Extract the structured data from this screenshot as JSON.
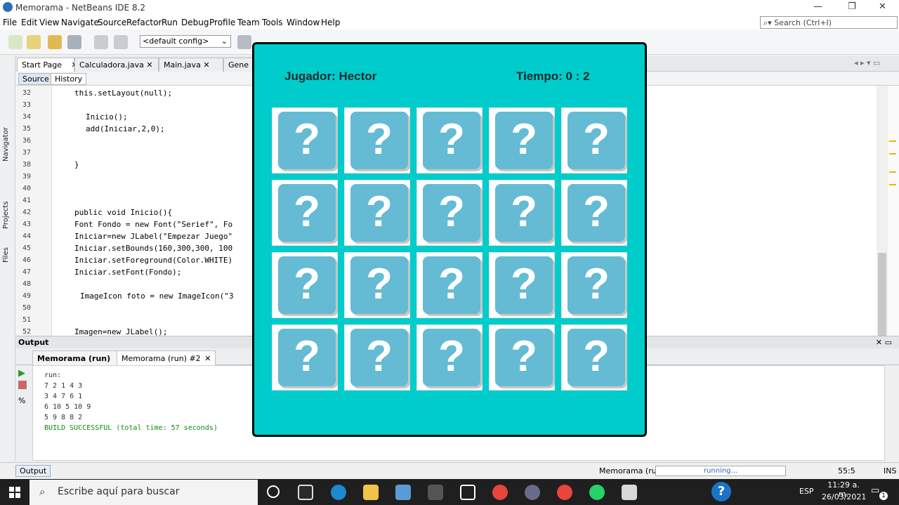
{
  "window": {
    "title": "Memorama - NetBeans IDE 8.2",
    "minimize": "—",
    "restore": "❐",
    "close": "✕"
  },
  "menu": [
    "File",
    "Edit",
    "View",
    "Navigate",
    "Source",
    "Refactor",
    "Run",
    "Debug",
    "Profile",
    "Team",
    "Tools",
    "Window",
    "Help"
  ],
  "toolbar": {
    "config_value": "<default config>"
  },
  "search": {
    "placeholder": "Search (Ctrl+I)"
  },
  "side_tabs": [
    "Navigator",
    "Projects",
    "Files"
  ],
  "editor_tabs": [
    "Start Page",
    "Calculadora.java",
    "Main.java",
    "Gene"
  ],
  "source_bar": {
    "source": "Source",
    "history": "History"
  },
  "code": {
    "lines": [
      {
        "n": "32",
        "text": "this.setLayout(null);"
      },
      {
        "n": "33",
        "text": ""
      },
      {
        "n": "34",
        "text": "Inicio();"
      },
      {
        "n": "35",
        "text": "add(Iniciar,2,0);"
      },
      {
        "n": "36",
        "text": ""
      },
      {
        "n": "37",
        "text": ""
      },
      {
        "n": "38",
        "text": "}"
      },
      {
        "n": "39",
        "text": ""
      },
      {
        "n": "40",
        "text": ""
      },
      {
        "n": "41",
        "text": ""
      },
      {
        "n": "42",
        "text": "public void Inicio(){"
      },
      {
        "n": "43",
        "text": "Font Fondo = new Font(\"Serief\", Fo"
      },
      {
        "n": "44",
        "text": "Iniciar=new JLabel(\"Empezar Juego\""
      },
      {
        "n": "45",
        "text": "Iniciar.setBounds(160,300,300, 100"
      },
      {
        "n": "46",
        "text": "Iniciar.setForeground(Color.WHITE)"
      },
      {
        "n": "47",
        "text": "Iniciar.setFont(Fondo);"
      },
      {
        "n": "48",
        "text": ""
      },
      {
        "n": "49",
        "text": "ImageIcon foto = new ImageIcon(\"3"
      },
      {
        "n": "50",
        "text": ""
      },
      {
        "n": "51",
        "text": ""
      },
      {
        "n": "52",
        "text": "Imagen=new JLabel();"
      }
    ]
  },
  "output": {
    "panel_title": "Output",
    "tabs": [
      "Memorama (run)",
      "Memorama (run) #2"
    ],
    "lines": [
      "run:",
      "7 2 1 4 3",
      "3 4 7 6 1",
      "6 10 5 10 9",
      "5 9 8 8 2",
      "BUILD SUCCESSFUL (total time: 57 seconds)"
    ]
  },
  "status": {
    "output_button": "Output",
    "project": "Memorama (run)",
    "progress": "running...",
    "position": "55:5",
    "mode": "INS"
  },
  "taskbar": {
    "search_placeholder": "Escribe aquí para buscar",
    "time": "11:29 a. m.",
    "date": "26/03/2021",
    "lang": "ESP",
    "notif_count": "1"
  },
  "game": {
    "player": "Jugador: Hector",
    "timer": "Tiempo: 0 : 2",
    "card_face": "?",
    "rows": 4,
    "cols": 5
  }
}
